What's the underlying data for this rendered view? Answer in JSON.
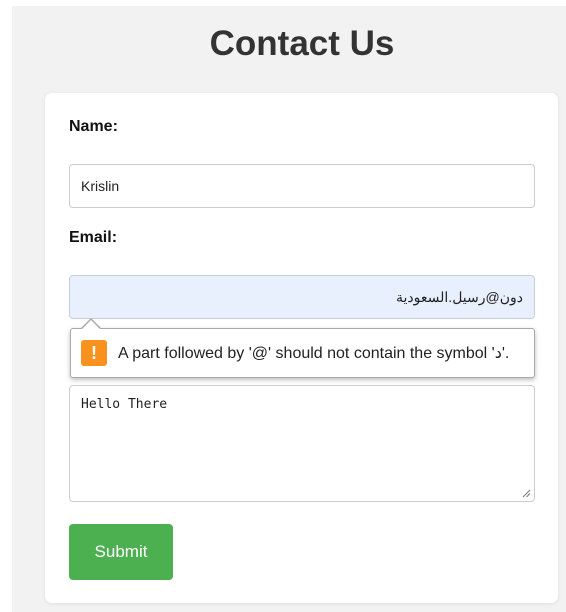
{
  "page": {
    "title": "Contact Us"
  },
  "form": {
    "name_label": "Name:",
    "name_value": "Krislin",
    "email_label": "Email:",
    "email_value": "دون@رسيل.السعودية",
    "message_value": "Hello There",
    "submit_label": "Submit"
  },
  "validation": {
    "message": "A part followed by '@' should not contain the symbol 'د'.",
    "icon": "warning-icon",
    "icon_glyph": "!"
  },
  "colors": {
    "submit_bg": "#4caf50",
    "warning": "#f7921e",
    "invalid_field_bg": "#e8f0fe"
  }
}
